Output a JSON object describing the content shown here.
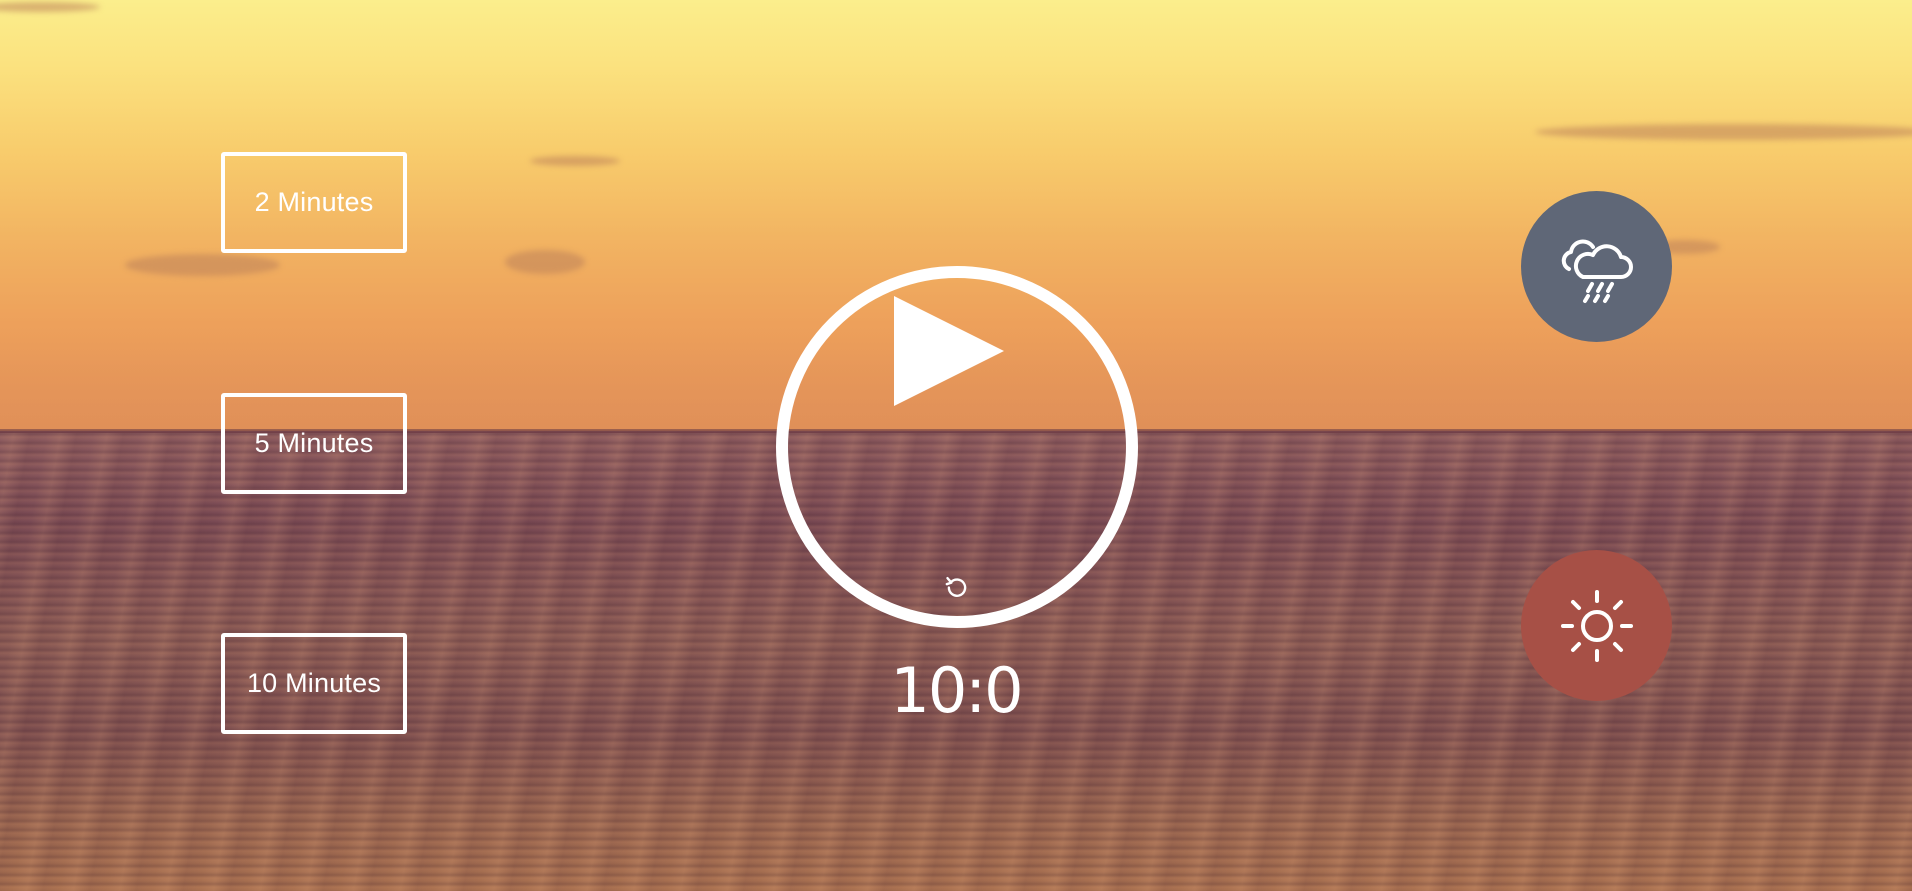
{
  "presets": {
    "two_min_label": "2 Minutes",
    "five_min_label": "5 Minutes",
    "ten_min_label": "10 Minutes"
  },
  "timer": {
    "display": "10:0"
  },
  "icons": {
    "play": "play-icon",
    "reset": "reset-icon",
    "rain": "rain-cloud-icon",
    "sun": "sun-icon"
  },
  "colors": {
    "rain_button": "#5f6777",
    "sun_button": "#a75046",
    "foreground": "#ffffff"
  }
}
